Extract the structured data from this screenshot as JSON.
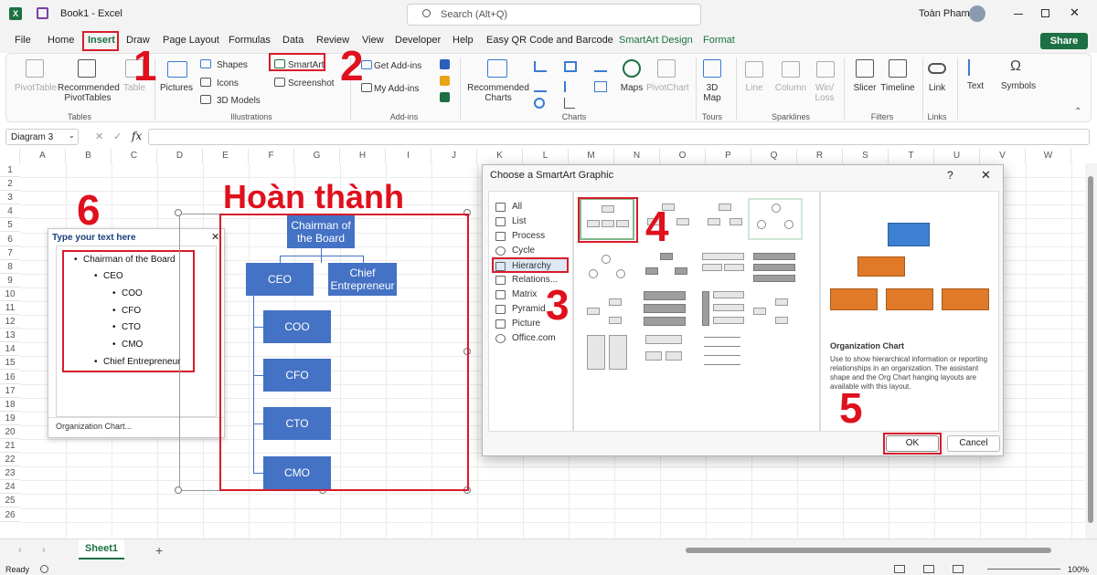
{
  "titlebar": {
    "title": "Book1 - Excel",
    "search_placeholder": "Search (Alt+Q)",
    "user": "Toàn Pham"
  },
  "menu": [
    "File",
    "Home",
    "Insert",
    "Draw",
    "Page Layout",
    "Formulas",
    "Data",
    "Review",
    "View",
    "Developer",
    "Help",
    "Easy QR Code and Barcode",
    "SmartArt Design",
    "Format"
  ],
  "menu_colored": [
    "SmartArt Design",
    "Format"
  ],
  "share_label": "Share",
  "ribbon": {
    "pivot": "PivotTable",
    "rec_pivot": "Recommended PivotTables",
    "table": "Table",
    "tables_group": "Tables",
    "pictures": "Pictures",
    "shapes": "Shapes",
    "icons": "Icons",
    "models": "3D Models",
    "smartart": "SmartArt",
    "screenshot": "Screenshot",
    "illus_group": "Illustrations",
    "get_addins": "Get Add-ins",
    "my_addins": "My Add-ins",
    "addins_group": "Add-ins",
    "rec_charts": "Recommended Charts",
    "maps": "Maps",
    "pivotchart": "PivotChart",
    "charts_group": "Charts",
    "map3d": "3D Map",
    "tours_group": "Tours",
    "line": "Line",
    "column": "Column",
    "winloss": "Win/ Loss",
    "spark_group": "Sparklines",
    "slicer": "Slicer",
    "timeline": "Timeline",
    "filters_group": "Filters",
    "link": "Link",
    "links_group": "Links",
    "text": "Text",
    "symbols": "Symbols"
  },
  "formula": {
    "namebox": "Diagram 3",
    "fx": "fx",
    "cancel": "✕",
    "confirm": "✓"
  },
  "columns": [
    "A",
    "B",
    "C",
    "D",
    "E",
    "F",
    "G",
    "H",
    "I",
    "J",
    "K",
    "L",
    "M",
    "N",
    "O",
    "P",
    "Q",
    "R",
    "S",
    "T",
    "U",
    "V",
    "W"
  ],
  "rows": [
    "1",
    "2",
    "3",
    "4",
    "5",
    "6",
    "7",
    "8",
    "9",
    "10",
    "11",
    "12",
    "13",
    "14",
    "15",
    "16",
    "17",
    "18",
    "19",
    "20",
    "21",
    "22",
    "23",
    "24",
    "25",
    "26"
  ],
  "steps": {
    "s1": "1",
    "s2": "2",
    "s3": "3",
    "s4": "4",
    "s5": "5",
    "s6": "6"
  },
  "done_label": "Hoàn thành",
  "text_pane": {
    "title": "Type your text here",
    "items": [
      "Chairman of the Board",
      "CEO",
      "COO",
      "CFO",
      "CTO",
      "CMO",
      "Chief Entrepreneur"
    ],
    "footer": "Organization Chart..."
  },
  "org": {
    "chairman": "Chairman of the Board",
    "ceo": "CEO",
    "chief": "Chief Entrepreneur",
    "coo": "COO",
    "cfo": "CFO",
    "cto": "CTO",
    "cmo": "CMO"
  },
  "dialog": {
    "title": "Choose a SmartArt Graphic",
    "help": "?",
    "close": "✕",
    "categories": [
      "All",
      "List",
      "Process",
      "Cycle",
      "Hierarchy",
      "Relations...",
      "Matrix",
      "Pyramid",
      "Picture",
      "Office.com"
    ],
    "selected_category": "Hierarchy",
    "preview_title": "Organization Chart",
    "preview_desc": "Use to show hierarchical information or reporting relationships in an organization. The assistant shape and the Org Chart hanging layouts are available with this layout.",
    "ok": "OK",
    "cancel": "Cancel"
  },
  "sheet": {
    "tab": "Sheet1",
    "add": "+"
  },
  "status": {
    "ready": "Ready",
    "zoom": "100%"
  }
}
